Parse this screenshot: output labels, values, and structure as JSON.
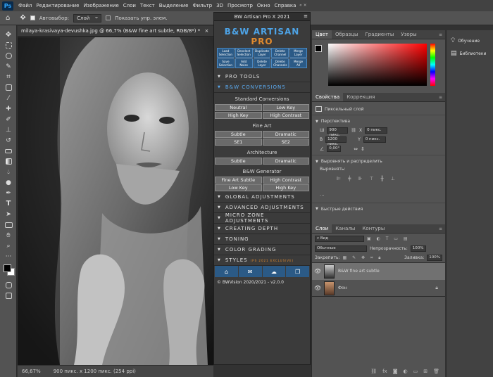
{
  "menubar": {
    "logo": "Ps",
    "items": [
      "Файл",
      "Редактирование",
      "Изображение",
      "Слои",
      "Текст",
      "Выделение",
      "Фильтр",
      "3D",
      "Просмотр",
      "Окно",
      "Справка"
    ]
  },
  "options": {
    "autoselect_label": "Автовыбор:",
    "layer_select": "Слой",
    "show_controls_label": "Показать упр. элем."
  },
  "document": {
    "tab_title": "milaya-krasivaya-devushka.jpg @ 66,7% (B&W fine art subtle, RGB/8*) *",
    "zoom": "66,67%",
    "size_info": "900 пикс. x 1200 пикс. (254 ppi)"
  },
  "plugin": {
    "title": "BW Artisan Pro X 2021",
    "logo_text": "B&W ARTISAN",
    "logo_suffix": "PRO",
    "top_buttons": [
      [
        "Load",
        "Selection"
      ],
      [
        "Deselect",
        "Selection"
      ],
      [
        "Duplicate",
        "Layer"
      ],
      [
        "Delete",
        "Channel"
      ],
      [
        "Merge",
        "Layer"
      ],
      [
        "Save",
        "Selection"
      ],
      [
        "Add",
        "Noise"
      ],
      [
        "Delete",
        "Layer"
      ],
      [
        "Delete",
        "Channels"
      ],
      [
        "Merge",
        "All"
      ]
    ],
    "sections_top": [
      "PRO TOOLS",
      "B&W CONVERSIONS"
    ],
    "standard_title": "Standard Conversions",
    "standard_buttons": [
      [
        "Neutral",
        "Low Key"
      ],
      [
        "High Key",
        "High Contrast"
      ]
    ],
    "fineart_title": "Fine Art",
    "fineart_buttons": [
      [
        "Subtle",
        "Dramatic"
      ],
      [
        "SE1",
        "SE2"
      ]
    ],
    "arch_title": "Architecture",
    "arch_buttons": [
      [
        "Subtle",
        "Dramatic"
      ]
    ],
    "generator_title": "B&W Generator",
    "generator_buttons": [
      [
        "Fine Art Subtle",
        "High Contrast"
      ],
      [
        "Low Key",
        "High Key"
      ]
    ],
    "sections_bottom": [
      "GLOBAL ADJUSTMENTS",
      "ADVANCED ADJUSTMENTS",
      "MICRO ZONE ADJUSTMENTS",
      "CREATING DEPTH",
      "TONING",
      "COLOR GRADING",
      "STYLES"
    ],
    "styles_badge": "(PS 2021 EXCLUSIVE)",
    "copyright": "© BWVision 2020/2021 - v2.0.0"
  },
  "color_panel": {
    "tabs": [
      "Цвет",
      "Образцы",
      "Градиенты",
      "Узоры"
    ]
  },
  "properties": {
    "tabs": [
      "Свойства",
      "Коррекция"
    ],
    "type_label": "Пиксельный слой",
    "transform_title": "Перспектива",
    "w_label": "Ш",
    "w_value": "900 пикс.",
    "x_label": "X",
    "x_value": "0 пикс.",
    "h_label": "В",
    "h_value": "1200 пикс.",
    "y_label": "Y",
    "y_value": "0 пикс.",
    "angle_value": "0,00°",
    "align_title": "Выровнять и распределить",
    "align_sub": "Выровнять:",
    "quick_title": "Быстрые действия"
  },
  "layers": {
    "tabs": [
      "Слои",
      "Каналы",
      "Контуры"
    ],
    "filter": "Вид",
    "blend_mode": "Обычные",
    "opacity_label": "Непрозрачность:",
    "opacity_value": "100%",
    "lock_label": "Закрепить:",
    "fill_label": "Заливка:",
    "fill_value": "100%",
    "items": [
      {
        "name": "B&W fine art subtle",
        "selected": true
      },
      {
        "name": "Фон",
        "selected": false
      }
    ]
  },
  "side_panel": {
    "items": [
      "Обучение",
      "Библиотеки"
    ]
  },
  "colors": {
    "accent_blue": "#2b5a86",
    "active_section": "#5aaaf0"
  }
}
